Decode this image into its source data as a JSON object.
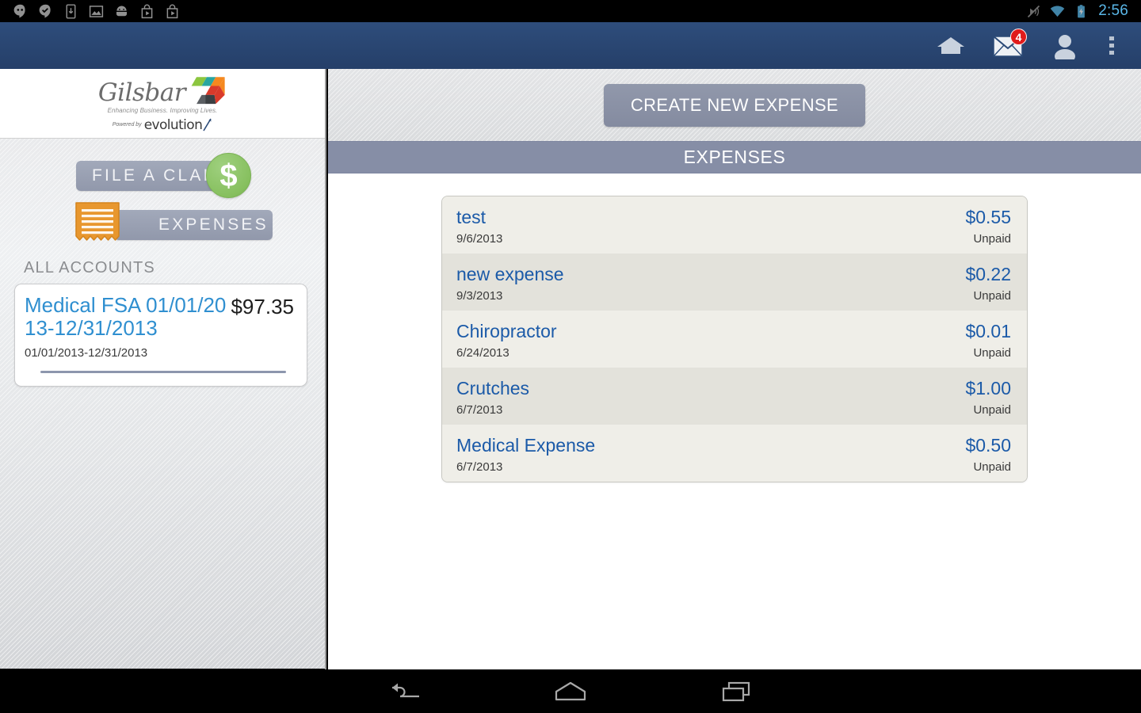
{
  "status_bar": {
    "clock": "2:56",
    "left_icons": [
      {
        "name": "hangouts-icon"
      },
      {
        "name": "message-check-icon"
      },
      {
        "name": "download-icon"
      },
      {
        "name": "image-icon"
      },
      {
        "name": "android-icon"
      },
      {
        "name": "play-store-icon"
      },
      {
        "name": "play-store-icon-2"
      }
    ],
    "right_icons": [
      {
        "name": "mute-icon"
      },
      {
        "name": "wifi-icon"
      },
      {
        "name": "battery-charging-icon"
      }
    ]
  },
  "action_bar": {
    "home_icon": "home-icon",
    "mail_icon": "mail-icon",
    "mail_badge": "4",
    "profile_icon": "person-icon",
    "overflow_icon": "overflow-menu-icon"
  },
  "sidebar": {
    "logo": {
      "brand": "Gilsbar",
      "tagline": "Enhancing Business. Improving Lives.",
      "powered_prefix": "Powered by",
      "powered_brand": "evolution"
    },
    "nav": {
      "file_claim_label": "FILE A CLAIM",
      "expenses_label": "EXPENSES"
    },
    "accounts_heading": "ALL ACCOUNTS",
    "account": {
      "name": "Medical FSA 01/01/2013-12/31/2013",
      "balance": "$97.35",
      "period": "01/01/2013-12/31/2013"
    }
  },
  "main": {
    "create_button": "CREATE NEW EXPENSE",
    "section_title": "EXPENSES",
    "expenses": [
      {
        "title": "test",
        "date": "9/6/2013",
        "amount": "$0.55",
        "status": "Unpaid"
      },
      {
        "title": "new expense",
        "date": "9/3/2013",
        "amount": "$0.22",
        "status": "Unpaid"
      },
      {
        "title": "Chiropractor",
        "date": "6/24/2013",
        "amount": "$0.01",
        "status": "Unpaid"
      },
      {
        "title": "Crutches",
        "date": "6/7/2013",
        "amount": "$1.00",
        "status": "Unpaid"
      },
      {
        "title": "Medical Expense",
        "date": "6/7/2013",
        "amount": "$0.50",
        "status": "Unpaid"
      }
    ]
  },
  "nav_bar": {
    "back_icon": "back-icon",
    "home_icon": "home-icon",
    "recents_icon": "recents-icon"
  },
  "colors": {
    "action_bar": "#2b4a77",
    "accent_blue": "#1b5aa8",
    "account_blue": "#2f8fd0",
    "header_slate": "#868ea6",
    "badge_red": "#e01b1b",
    "money_green": "#87c05f",
    "receipt_orange": "#e8972e"
  }
}
